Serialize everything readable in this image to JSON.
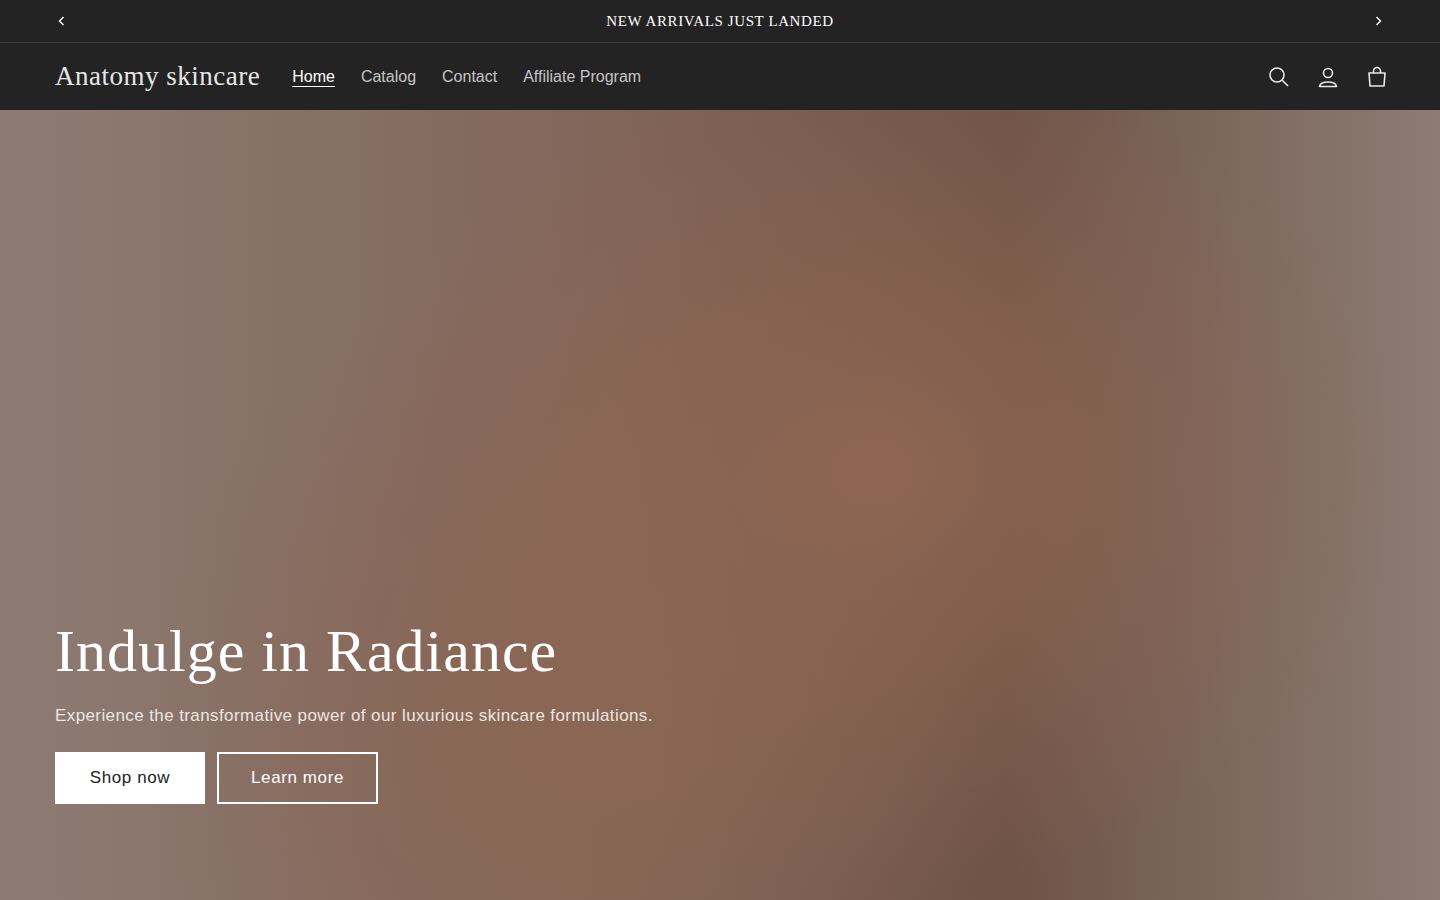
{
  "announcement": {
    "text": "NEW ARRIVALS JUST LANDED"
  },
  "header": {
    "logo": "Anatomy skincare",
    "nav": [
      {
        "label": "Home",
        "selected": true
      },
      {
        "label": "Catalog",
        "selected": false
      },
      {
        "label": "Contact",
        "selected": false
      },
      {
        "label": "Affiliate Program",
        "selected": false
      }
    ]
  },
  "hero": {
    "heading": "Indulge in Radiance",
    "subtitle": "Experience the transformative power of our luxurious skincare formulations.",
    "buttons": [
      {
        "label": "Shop now",
        "kind": "primary"
      },
      {
        "label": "Learn more",
        "kind": "secondary"
      }
    ]
  }
}
